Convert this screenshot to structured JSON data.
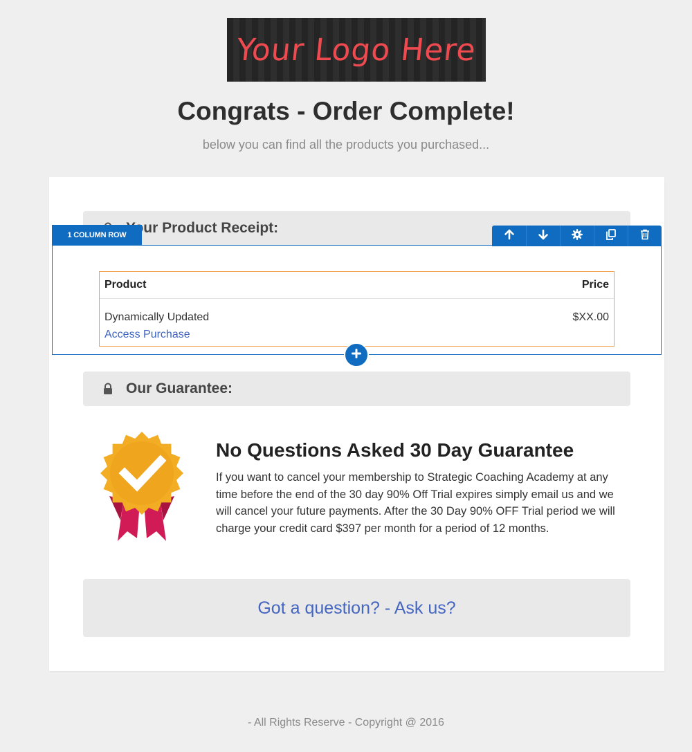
{
  "logo": {
    "text": "Your Logo Here",
    "text_color": "#ef4a4f"
  },
  "header": {
    "title": "Congrats - Order Complete!",
    "subtitle": "below you can find all the products you purchased..."
  },
  "receipt": {
    "header": "Your Product Receipt:",
    "icon": "lock-icon"
  },
  "editor": {
    "row_badge": "1 COLUMN ROW",
    "toolbar_icons": [
      "arrow-up-icon",
      "arrow-down-icon",
      "gear-icon",
      "copy-icon",
      "trash-icon"
    ],
    "accent_color": "#0f6cc0"
  },
  "product_table": {
    "col_product": "Product",
    "col_price": "Price",
    "row": {
      "product": "Dynamically Updated",
      "link": "Access Purchase",
      "price": "$XX.00"
    }
  },
  "guarantee": {
    "header": "Our Guarantee:",
    "icon": "lock-icon",
    "title": "No Questions Asked 30 Day Guarantee",
    "body": "If you want to cancel your membership to Strategic Coaching Academy at any time before the end of the 30 day 90% Off Trial expires simply email us and we will cancel your future payments. After the 30 Day 90% OFF Trial period we will charge your credit card $397 per month for a period of 12 months."
  },
  "question": {
    "link": "Got a question? - Ask us?"
  },
  "footer": {
    "text": "- All Rights Reserve - Copyright @ 2016"
  }
}
